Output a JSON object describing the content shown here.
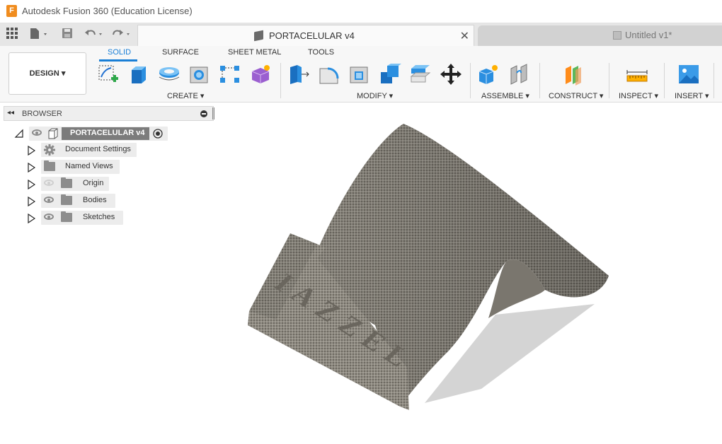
{
  "window": {
    "title": "Autodesk Fusion 360 (Education License)",
    "logo_letter": "F"
  },
  "tabs": [
    {
      "label": "PORTACELULAR v4",
      "active": true
    },
    {
      "label": "Untitled v1*",
      "active": false
    }
  ],
  "workspace": {
    "label": "DESIGN"
  },
  "ribbon_tabs": [
    "SOLID",
    "SURFACE",
    "SHEET METAL",
    "TOOLS"
  ],
  "groups": {
    "create": "CREATE",
    "modify": "MODIFY",
    "assemble": "ASSEMBLE",
    "construct": "CONSTRUCT",
    "inspect": "INSPECT",
    "insert": "INSERT"
  },
  "browser": {
    "title": "BROWSER",
    "root": "PORTACELULAR v4",
    "items": [
      {
        "label": "Document Settings",
        "icon": "gear-icon"
      },
      {
        "label": "Named Views",
        "icon": "folder-icon"
      },
      {
        "label": "Origin",
        "icon": "folder-icon",
        "visibility": "hidden"
      },
      {
        "label": "Bodies",
        "icon": "folder-icon",
        "visibility": "visible"
      },
      {
        "label": "Sketches",
        "icon": "folder-icon",
        "visibility": "visible"
      }
    ]
  },
  "model": {
    "engraved_text": "IAZZEL"
  },
  "colors": {
    "accent": "#1a7fd6",
    "logo": "#f08c1e",
    "model": "#8a867c"
  }
}
